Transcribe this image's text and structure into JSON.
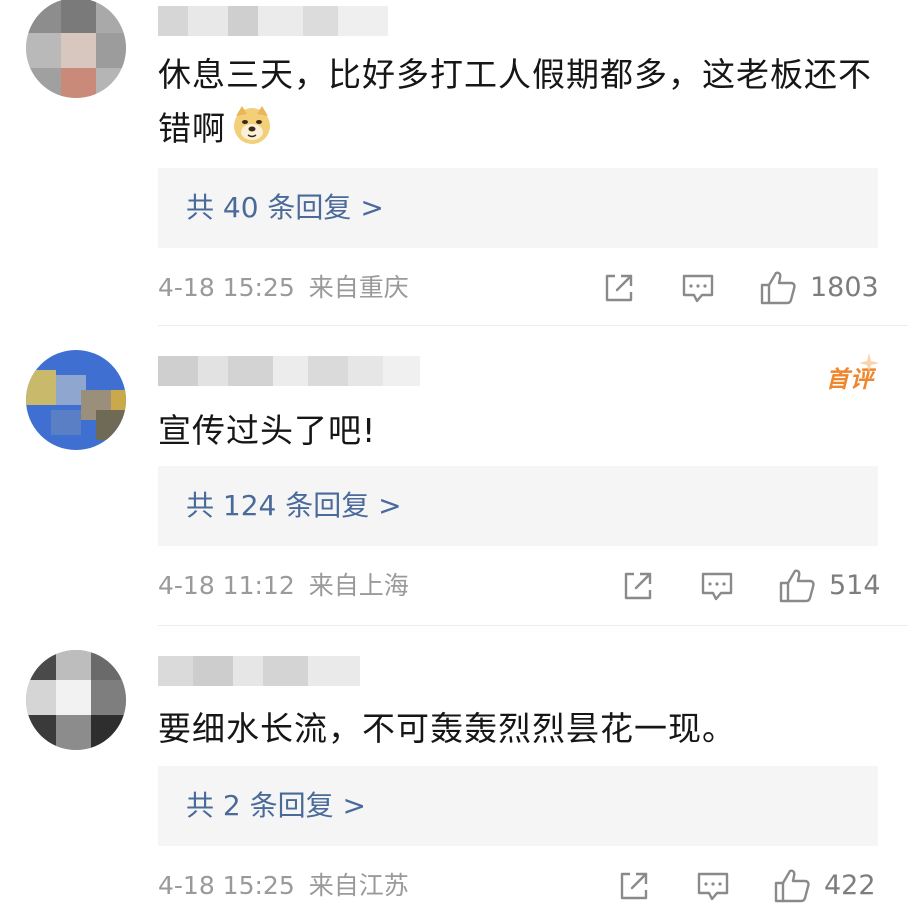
{
  "comments": [
    {
      "text": "休息三天，比好多打工人假期都多，这老板还不错啊",
      "emoji": "doge-emoji",
      "replies": "共 40 条回复 >",
      "date": "4-18 15:25",
      "location": "来自重庆",
      "likes": "1803"
    },
    {
      "text": "宣传过头了吧!",
      "badge": "首评",
      "replies": "共 124 条回复 >",
      "date": "4-18 11:12",
      "location": "来自上海",
      "likes": "514"
    },
    {
      "text": "要细水长流，不可轰轰烈烈昙花一现。",
      "replies": "共 2 条回复 >",
      "date": "4-18 15:25",
      "location": "来自江苏",
      "likes": "422"
    }
  ],
  "icons": {
    "share": "share-icon",
    "comment": "comment-icon",
    "like": "thumbs-up-icon"
  },
  "colors": {
    "reply_link": "#4a6a9a",
    "badge": "#f0852b",
    "meta": "#9a9a9a",
    "reply_bg": "#f5f5f5"
  }
}
